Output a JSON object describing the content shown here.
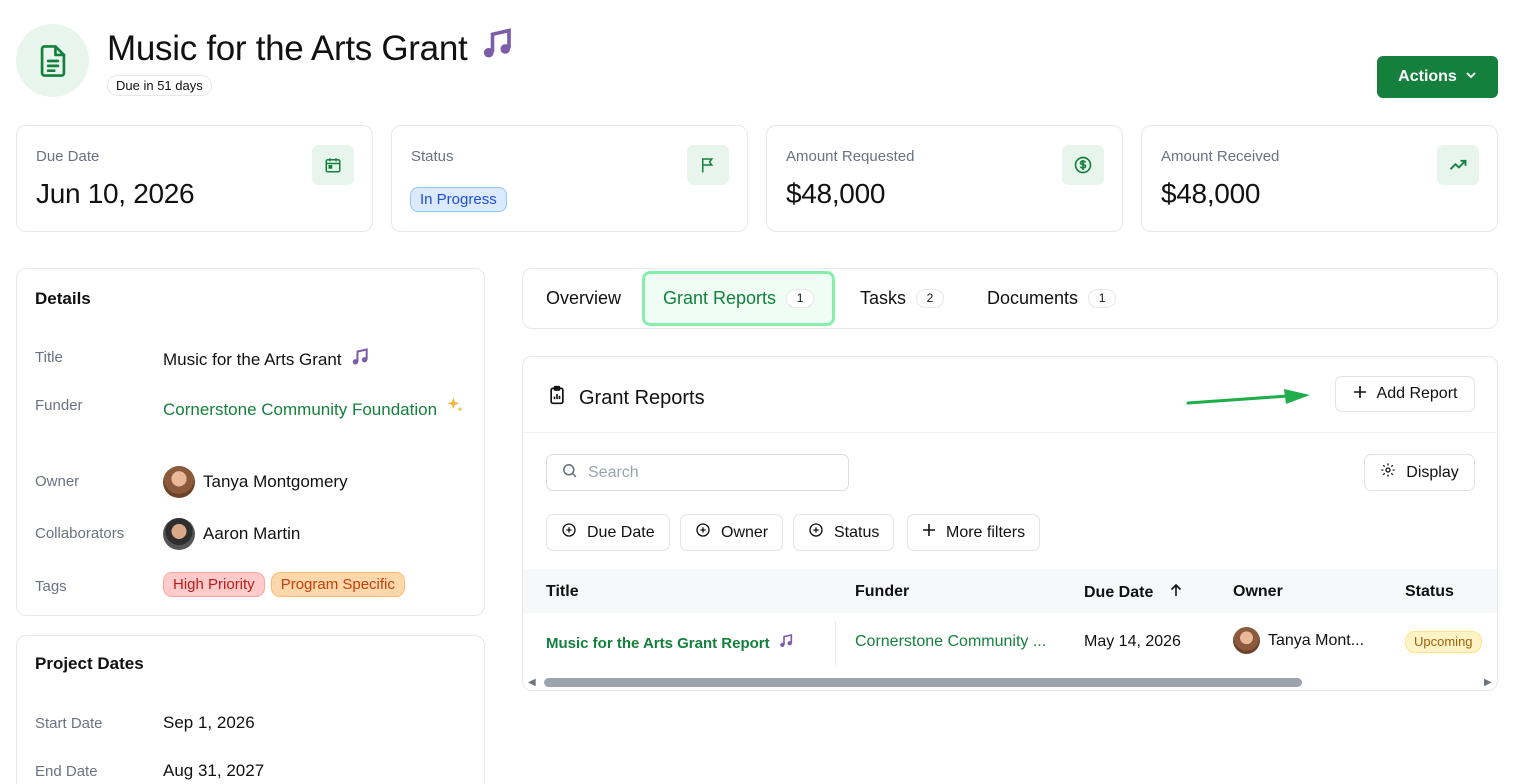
{
  "header": {
    "title": "Music for the Arts Grant",
    "due_badge": "Due in 51 days",
    "actions_label": "Actions"
  },
  "stats": {
    "due_date": {
      "label": "Due Date",
      "value": "Jun 10, 2026"
    },
    "status": {
      "label": "Status",
      "value": "In Progress"
    },
    "amount_requested": {
      "label": "Amount Requested",
      "value": "$48,000"
    },
    "amount_received": {
      "label": "Amount Received",
      "value": "$48,000"
    }
  },
  "details": {
    "heading": "Details",
    "title_label": "Title",
    "title_value": "Music for the Arts Grant",
    "funder_label": "Funder",
    "funder_value": "Cornerstone Community Foundation",
    "owner_label": "Owner",
    "owner_value": "Tanya Montgomery",
    "collaborators_label": "Collaborators",
    "collaborators_value": "Aaron Martin",
    "tags_label": "Tags",
    "tags": [
      "High Priority",
      "Program Specific"
    ]
  },
  "project_dates": {
    "heading": "Project Dates",
    "start_label": "Start Date",
    "start_value": "Sep 1, 2026",
    "end_label": "End Date",
    "end_value": "Aug 31, 2027"
  },
  "tabs": [
    {
      "label": "Overview",
      "count": ""
    },
    {
      "label": "Grant Reports",
      "count": "1"
    },
    {
      "label": "Tasks",
      "count": "2"
    },
    {
      "label": "Documents",
      "count": "1"
    }
  ],
  "reports": {
    "heading": "Grant Reports",
    "add_label": "Add Report",
    "search_placeholder": "Search",
    "display_label": "Display",
    "filters": [
      "Due Date",
      "Owner",
      "Status",
      "More filters"
    ],
    "columns": [
      "Title",
      "Funder",
      "Due Date",
      "Owner",
      "Status"
    ],
    "rows": [
      {
        "title": "Music for the Arts Grant Report",
        "funder": "Cornerstone Community ...",
        "due_date": "May 14, 2026",
        "owner": "Tanya Mont...",
        "status": "Upcoming"
      }
    ]
  },
  "colors": {
    "accent": "#15803d",
    "accent_soft": "#e8f5ec",
    "status_blue": "#dbeafe",
    "tag_red": "#fecaca",
    "tag_orange": "#fed7aa",
    "badge_yellow": "#fef3c7"
  }
}
